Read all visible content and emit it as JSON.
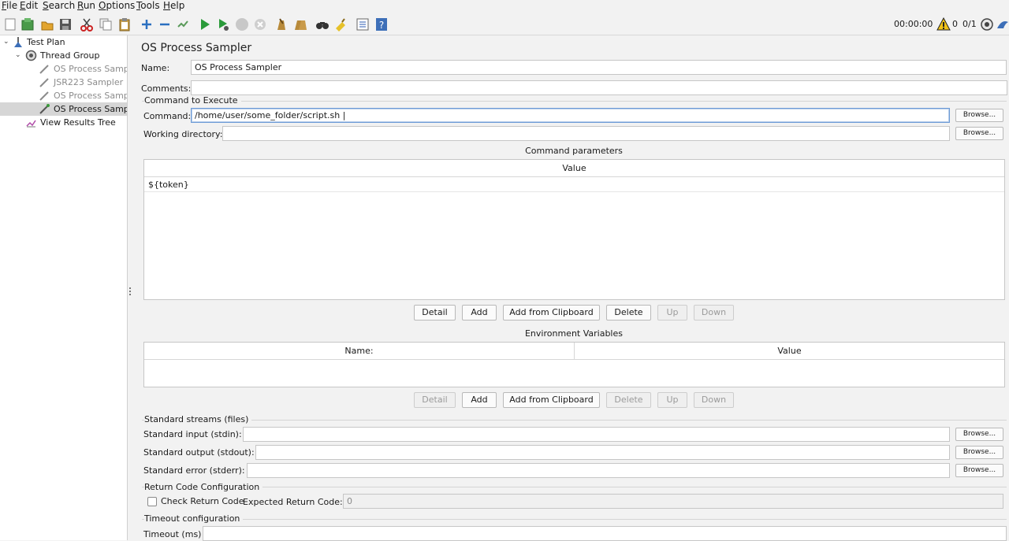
{
  "menu": [
    {
      "pre": "",
      "key": "F",
      "post": "ile"
    },
    {
      "pre": "",
      "key": "E",
      "post": "dit"
    },
    {
      "pre": "",
      "key": "S",
      "post": "earch"
    },
    {
      "pre": "",
      "key": "R",
      "post": "un"
    },
    {
      "pre": "",
      "key": "O",
      "post": "ptions"
    },
    {
      "pre": "",
      "key": "T",
      "post": "ools"
    },
    {
      "pre": "",
      "key": "H",
      "post": "elp"
    }
  ],
  "toolbar": {
    "timer": "00:00:00",
    "warning_count": "0",
    "threads": "0/1"
  },
  "tree": {
    "items": [
      {
        "label": "Test Plan",
        "icon": "test-plan-icon",
        "expanded": "v"
      },
      {
        "label": "Thread Group",
        "icon": "thread-group-icon",
        "expanded": "v"
      },
      {
        "label": "OS Process Sampler",
        "icon": "pipette-icon"
      },
      {
        "label": "JSR223 Sampler",
        "icon": "pipette-icon"
      },
      {
        "label": "OS Process Sampler",
        "icon": "pipette-icon"
      },
      {
        "label": "OS Process Sampler",
        "icon": "pipette-icon"
      },
      {
        "label": "View Results Tree",
        "icon": "results-tree-icon"
      }
    ]
  },
  "panel": {
    "title": "OS Process Sampler",
    "name_label": "Name:",
    "name_value": "OS Process Sampler",
    "comments_label": "Comments:",
    "comments_value": "",
    "command_section": "Command to Execute",
    "command_label": "Command:",
    "command_value": "/home/user/some_folder/script.sh |",
    "working_dir_label": "Working directory:",
    "working_dir_value": "",
    "browse": "Browse...",
    "params_title": "Command parameters",
    "params_header": "Value",
    "params_rows": [
      "${token}"
    ],
    "params_buttons": {
      "detail": "Detail",
      "add": "Add",
      "add_clip": "Add from Clipboard",
      "delete": "Delete",
      "up": "Up",
      "down": "Down"
    },
    "env_title": "Environment Variables",
    "env_header_name": "Name:",
    "env_header_value": "Value",
    "streams_section": "Standard streams (files)",
    "stdin_label": "Standard input (stdin):",
    "stdout_label": "Standard output (stdout):",
    "stderr_label": "Standard error (stderr):",
    "return_section": "Return Code Configuration",
    "check_return_label": "Check Return Code",
    "expected_label": "Expected Return Code:",
    "expected_value": "0",
    "timeout_section": "Timeout configuration",
    "timeout_label": "Timeout (ms)"
  }
}
